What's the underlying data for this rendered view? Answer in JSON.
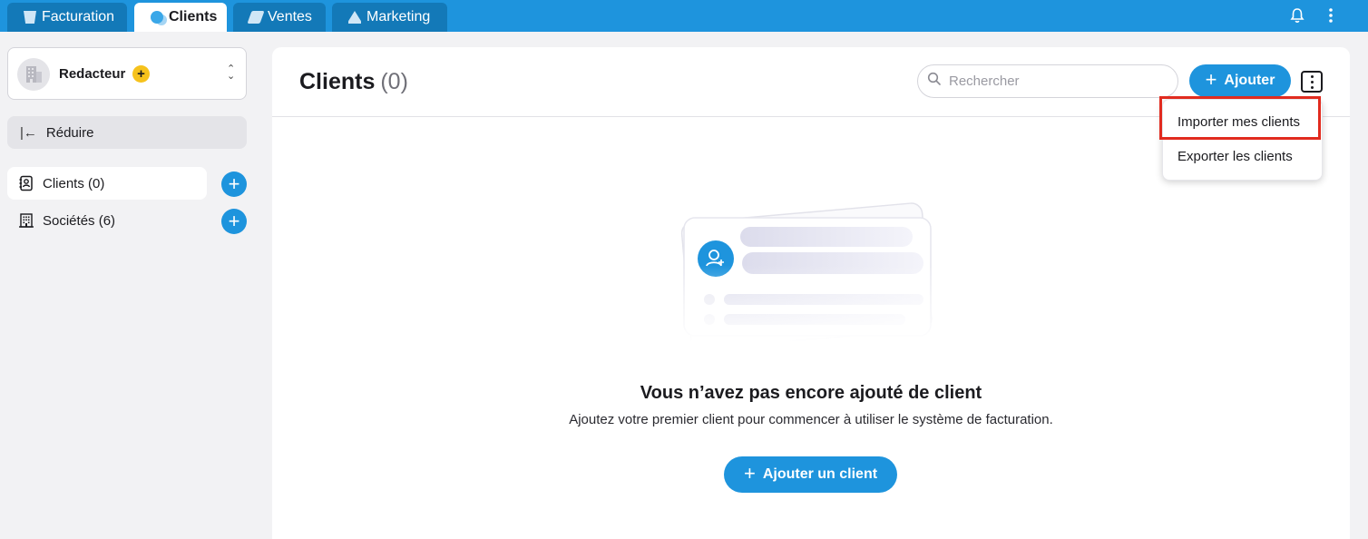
{
  "app_tabs": [
    {
      "label": "Facturation",
      "icon": "invoice-icon",
      "active": false
    },
    {
      "label": "Clients",
      "icon": "clients-icon",
      "active": true
    },
    {
      "label": "Ventes",
      "icon": "sales-icon",
      "active": false
    },
    {
      "label": "Marketing",
      "icon": "marketing-icon",
      "active": false
    }
  ],
  "topbar_icons": [
    "bell-icon",
    "more-vertical-icon"
  ],
  "workspace": {
    "name": "Redacteur",
    "badge": "+"
  },
  "sidebar": {
    "collapse_label": "Réduire",
    "items": [
      {
        "label": "Clients (0)",
        "icon": "contacts-book-icon",
        "active": true
      },
      {
        "label": "Sociétés (6)",
        "icon": "building-icon",
        "active": false
      }
    ]
  },
  "main": {
    "title": "Clients",
    "count": "(0)",
    "search_placeholder": "Rechercher",
    "add_label": "Ajouter"
  },
  "dropdown": {
    "items": [
      "Importer mes clients",
      "Exporter les clients"
    ]
  },
  "empty_state": {
    "title": "Vous n’avez pas encore ajouté de client",
    "subtitle": "Ajoutez votre premier client pour commencer à utiliser le système de facturation.",
    "button_label": "Ajouter un client"
  },
  "colors": {
    "accent": "#1e94dd",
    "topbar": "#1e94dd",
    "highlight": "#e12b1f",
    "badge": "#f6c21c"
  }
}
